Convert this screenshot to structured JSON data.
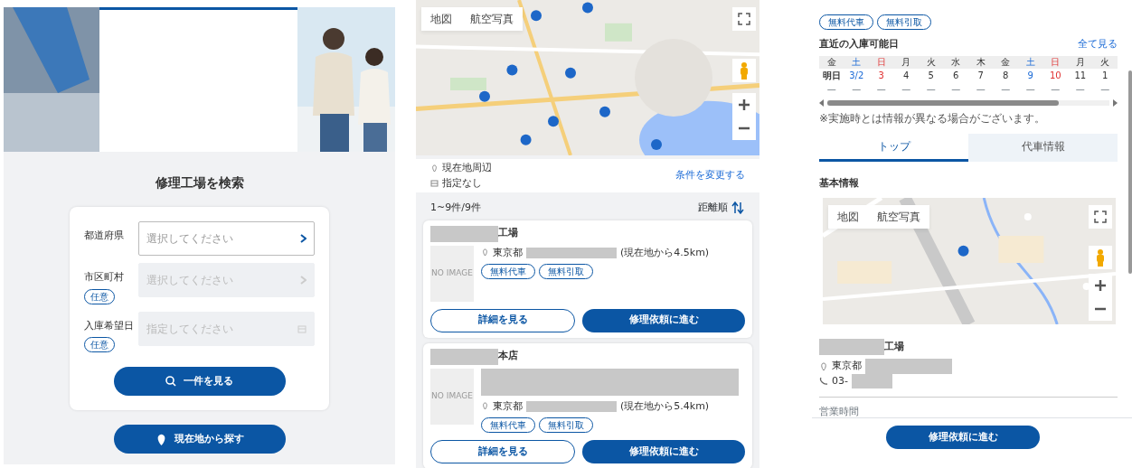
{
  "search_panel": {
    "title": "修理工場を検索",
    "fields": [
      {
        "label": "都道府県",
        "placeholder": "選択してください",
        "kind": "select",
        "disabled": false
      },
      {
        "label": "市区町村",
        "tag": "任意",
        "placeholder": "選択してください",
        "kind": "select",
        "disabled": true
      },
      {
        "label": "入庫希望日",
        "tag": "任意",
        "placeholder": "指定してください",
        "kind": "date",
        "disabled": true
      }
    ],
    "search_button": "一件を見る",
    "location_button": "現在地から探す"
  },
  "results_panel": {
    "map": {
      "buttons": [
        "地図",
        "航空写真"
      ]
    },
    "conditions": [
      {
        "kind": "location",
        "text": "現在地周辺"
      },
      {
        "kind": "date",
        "text": "指定なし"
      }
    ],
    "change_link": "条件を変更する",
    "count": "1~9件/9件",
    "sort": "距離順",
    "shops": [
      {
        "name": "工場",
        "name_redacted": true,
        "description_redacted": false,
        "image": "NO IMAGE",
        "address": "東京都",
        "address_redacted": true,
        "distance": "(現在地から4.5km)",
        "tags": [
          "無料代車",
          "無料引取"
        ],
        "buttons": [
          "詳細を見る",
          "修理依頼に進む"
        ]
      },
      {
        "name": "本店",
        "name_redacted": true,
        "description_redacted": true,
        "image": "NO IMAGE",
        "address": "東京都",
        "address_redacted": true,
        "distance": "(現在地から5.4km)",
        "tags": [
          "無料代車",
          "無料引取"
        ],
        "buttons": [
          "詳細を見る",
          "修理依頼に進む"
        ]
      }
    ]
  },
  "detail_panel": {
    "tags": [
      "無料代車",
      "無料引取"
    ],
    "availability_title": "直近の入庫可能日",
    "see_all": "全て見る",
    "calendar": [
      {
        "day": "金",
        "date": "明日",
        "status": "—",
        "kind": "weekday"
      },
      {
        "day": "土",
        "date": "3/2",
        "status": "—",
        "kind": "saturday"
      },
      {
        "day": "日",
        "date": "3",
        "status": "—",
        "kind": "sunday"
      },
      {
        "day": "月",
        "date": "4",
        "status": "—",
        "kind": "weekday"
      },
      {
        "day": "火",
        "date": "5",
        "status": "—",
        "kind": "weekday"
      },
      {
        "day": "水",
        "date": "6",
        "status": "—",
        "kind": "weekday"
      },
      {
        "day": "木",
        "date": "7",
        "status": "—",
        "kind": "weekday"
      },
      {
        "day": "金",
        "date": "8",
        "status": "—",
        "kind": "weekday"
      },
      {
        "day": "土",
        "date": "9",
        "status": "—",
        "kind": "saturday"
      },
      {
        "day": "日",
        "date": "10",
        "status": "—",
        "kind": "sunday"
      },
      {
        "day": "月",
        "date": "11",
        "status": "—",
        "kind": "weekday"
      },
      {
        "day": "火",
        "date": "1",
        "status": "—",
        "kind": "weekday"
      }
    ],
    "note": "※実施時とは情報が異なる場合がございます。",
    "tabs": [
      {
        "label": "トップ",
        "selected": true
      },
      {
        "label": "代車情報",
        "selected": false
      }
    ],
    "section_title": "基本情報",
    "map": {
      "buttons": [
        "地図",
        "航空写真"
      ]
    },
    "shop": {
      "name": "工場",
      "name_redacted": true,
      "address": "東京都",
      "address_redacted": true,
      "phone": "03-",
      "phone_redacted": true
    },
    "hours_label": "営業時間",
    "footer_button": "修理依頼に進む"
  }
}
